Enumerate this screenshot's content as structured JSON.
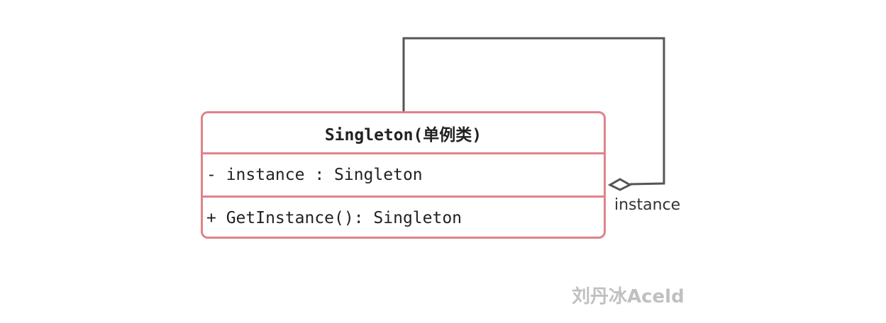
{
  "class": {
    "name": "Singleton(单例类)",
    "attributes": [
      "- instance : Singleton"
    ],
    "methods": [
      "+ GetInstance(): Singleton"
    ]
  },
  "association": {
    "label": "instance",
    "type": "aggregation",
    "self_reference": true
  },
  "watermark": {
    "text": "刘丹冰Aceld"
  },
  "colors": {
    "class_border": "#e0828a",
    "connector": "#555555",
    "text": "#222222",
    "watermark": "#c0c0c0"
  }
}
